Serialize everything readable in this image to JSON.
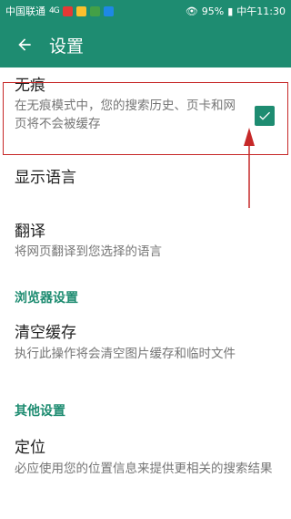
{
  "status_bar": {
    "carrier": "中国联通",
    "signal": "4G",
    "battery": "95%",
    "time": "中午11:30"
  },
  "toolbar": {
    "back_icon": "arrow-back-icon",
    "title": "设置"
  },
  "settings": {
    "incognito": {
      "title": "无痕",
      "summary": "在无痕模式中，您的搜索历史、页卡和网页将不会被缓存",
      "checked": true
    },
    "language": {
      "title": "显示语言"
    },
    "translate": {
      "title": "翻译",
      "summary": "将网页翻译到您选择的语言"
    },
    "browser_section": "浏览器设置",
    "clear_cache": {
      "title": "清空缓存",
      "summary": "执行此操作将会清空图片缓存和临时文件"
    },
    "other_section": "其他设置",
    "location": {
      "title": "定位",
      "summary": "必应使用您的位置信息来提供更相关的搜索结果"
    }
  },
  "colors": {
    "primary": "#1e8c71",
    "annotation": "#c62828",
    "title_text": "#212121",
    "summary_text": "#757575"
  }
}
